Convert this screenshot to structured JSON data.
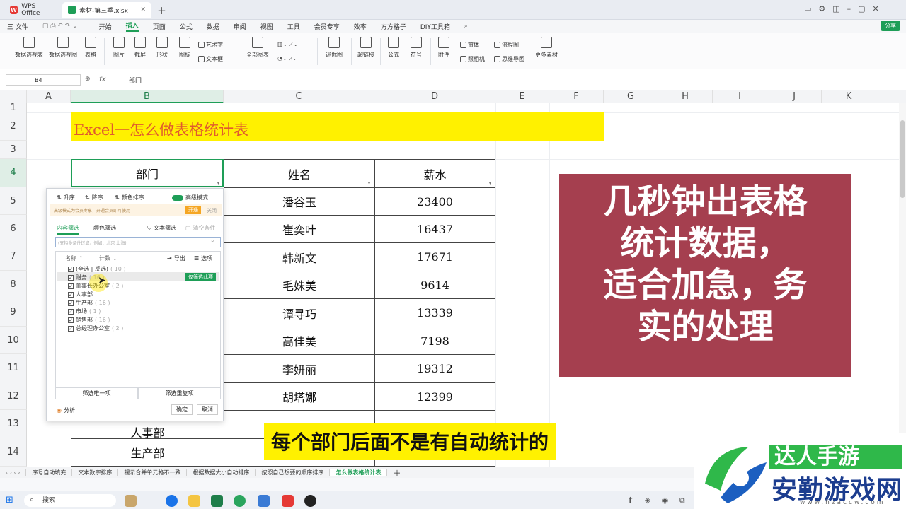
{
  "titlebar": {
    "app_tab": "WPS Office",
    "file_tab": "素材-第三季.xlsx"
  },
  "menubar": {
    "file": "三 文件",
    "items": [
      "开始",
      "插入",
      "页面",
      "公式",
      "数据",
      "审阅",
      "视图",
      "工具",
      "会员专享",
      "效率",
      "方方格子",
      "DIY工具箱"
    ],
    "active_index": 1,
    "share": "分享"
  },
  "ribbon": {
    "big_buttons": [
      "数据透视表",
      "数据透视图",
      "表格",
      "图片",
      "截屏",
      "形状",
      "图标",
      "全部图表",
      "迷你图",
      "超链接",
      "公式",
      "符号",
      "附件",
      "更多素材"
    ],
    "small_buttons": [
      "艺术字",
      "文本框",
      "窗体",
      "照相机",
      "流程图",
      "思维导图"
    ]
  },
  "formulabar": {
    "cell_ref": "B4",
    "fx": "fx",
    "value": "部门"
  },
  "columns": [
    "A",
    "B",
    "C",
    "D",
    "E",
    "F",
    "G",
    "H",
    "I",
    "J",
    "K"
  ],
  "rows": [
    "1",
    "2",
    "3",
    "4",
    "5",
    "6",
    "7",
    "8",
    "9",
    "10",
    "11",
    "12",
    "13",
    "14"
  ],
  "sheet": {
    "title": "Excel一怎么做表格统计表",
    "headers": [
      "部门",
      "姓名",
      "薪水"
    ],
    "names": [
      "潘谷玉",
      "崔奕叶",
      "韩新文",
      "毛姝美",
      "谭寻巧",
      "高佳美",
      "李妍丽",
      "胡塔娜"
    ],
    "salaries": [
      "23400",
      "16437",
      "17671",
      "9614",
      "13339",
      "7198",
      "19312",
      "12399"
    ],
    "partial_row": [
      "人事部",
      "",
      ""
    ],
    "row14": [
      "生产部",
      "",
      ""
    ]
  },
  "filter_panel": {
    "sort_asc": "升序",
    "sort_desc": "降序",
    "color_sort": "颜色排序",
    "advanced": "高级模式",
    "tip": "高级模式为会员专享，开通会员即可使用",
    "open": "开通",
    "close": "关闭",
    "tab_content": "内容筛选",
    "tab_color": "颜色筛选",
    "text_filter": "文本筛选",
    "clear": "清空条件",
    "search_placeholder": "(支持多条件过滤，例如：北京 上海)",
    "col_name": "名称",
    "col_count": "计数",
    "export": "导出",
    "options": "选项",
    "items": [
      {
        "label": "(全选 | 反选)",
        "count": "( 10 )",
        "checked": true
      },
      {
        "label": "财务",
        "count": "( 16 )",
        "checked": true
      },
      {
        "label": "董事长办公室",
        "count": "( 2 )",
        "checked": true
      },
      {
        "label": "人事部",
        "count": "",
        "checked": true
      },
      {
        "label": "生产部",
        "count": "( 16 )",
        "checked": true
      },
      {
        "label": "市场",
        "count": "( 1 )",
        "checked": true
      },
      {
        "label": "销售部",
        "count": "( 16 )",
        "checked": true
      },
      {
        "label": "总经理办公室",
        "count": "( 2 )",
        "checked": true
      }
    ],
    "only_filter": "仅筛选此项",
    "filter_one": "筛选唯一项",
    "filter_dup": "筛选重复项",
    "analysis": "分析",
    "ok": "确定",
    "cancel": "取消"
  },
  "overlay": {
    "lines": [
      "几秒钟出表格",
      "统计数据，",
      "适合加急，务",
      "实的处理"
    ],
    "subtitle": "每个部门后面不是有自动统计的"
  },
  "sheet_tabs": [
    "序号自动填充",
    "文本数字排序",
    "提示合并单元格不一致",
    "根据数据大小自动排序",
    "按照自己想要的顺序排序",
    "怎么做表格统计表"
  ],
  "active_sheet_index": 5,
  "taskbar": {
    "search": "搜索"
  },
  "watermark": {
    "top": "达人手游",
    "main": "安勤游戏网",
    "url": "www.hzaccw.com"
  }
}
